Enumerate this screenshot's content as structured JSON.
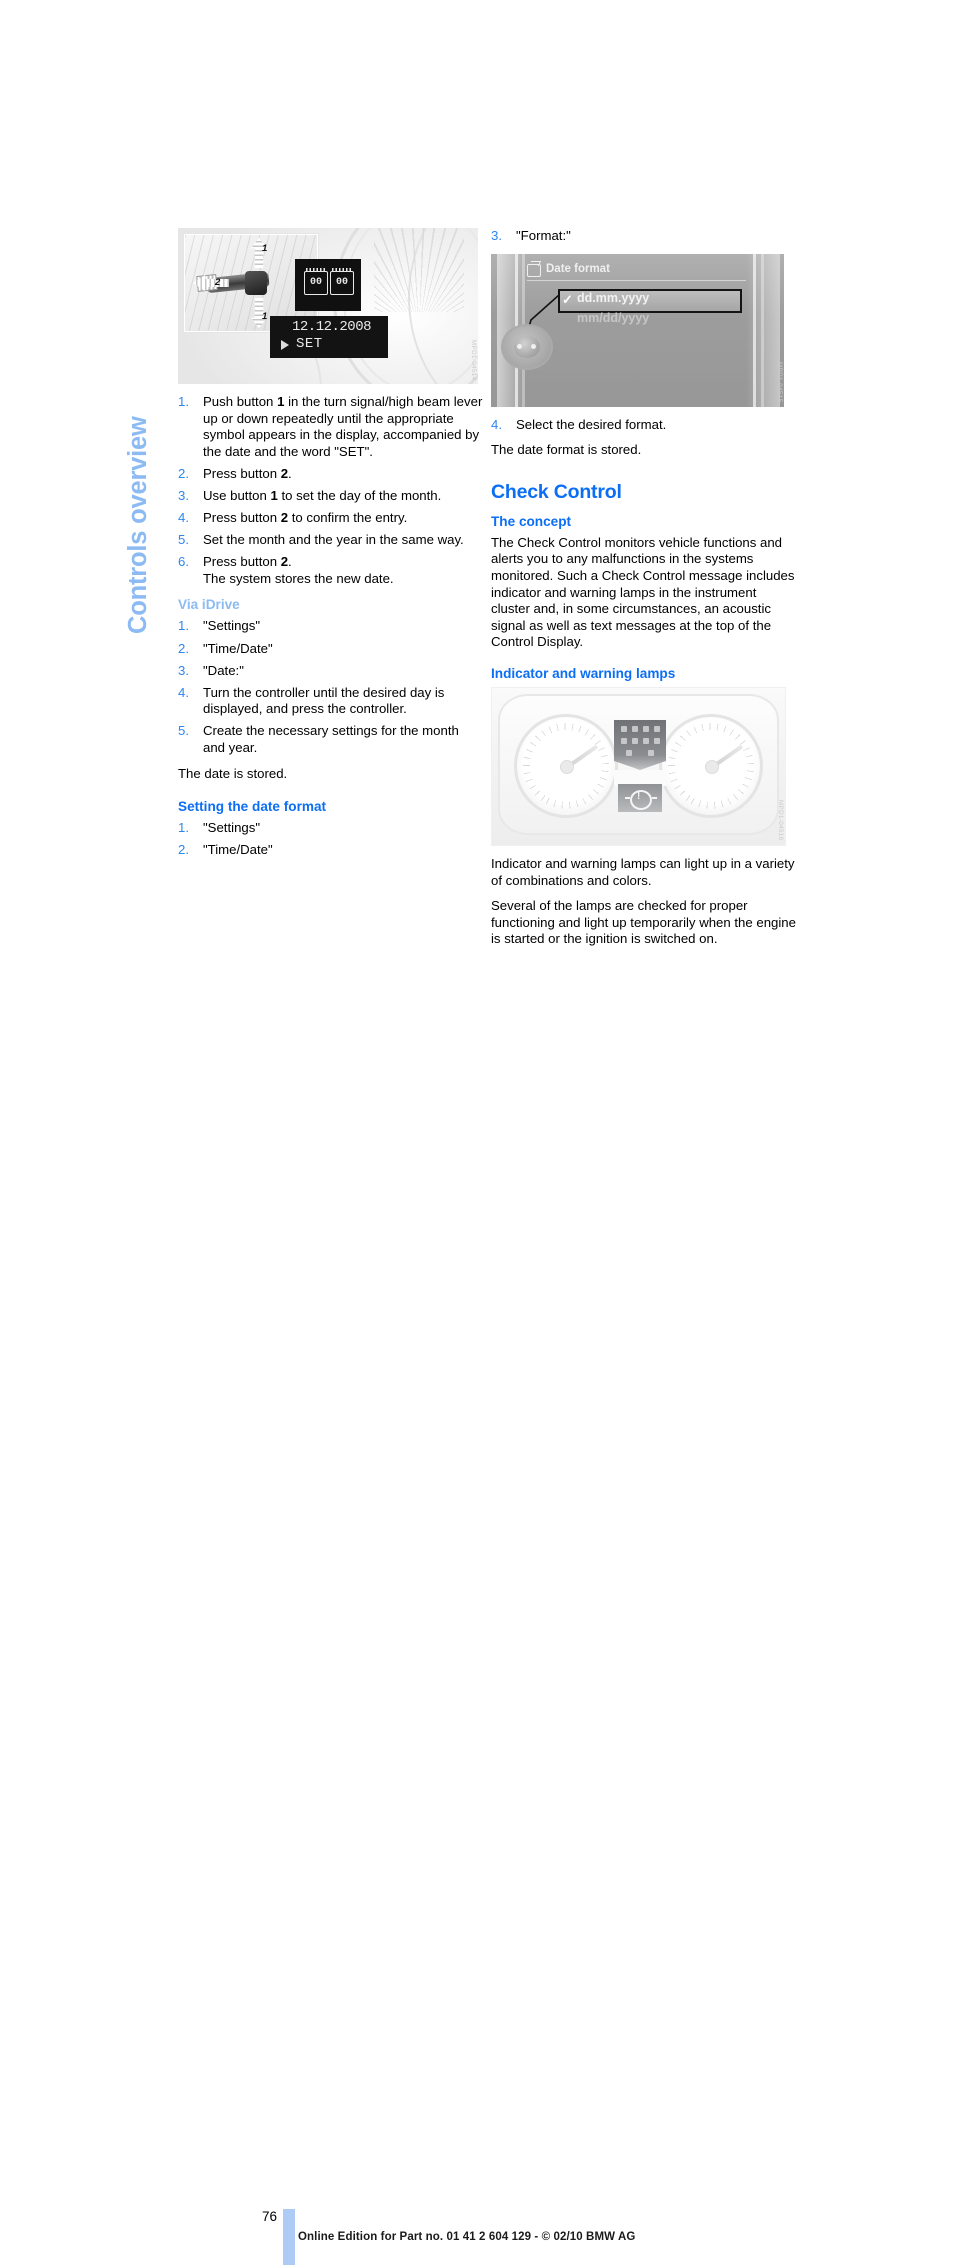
{
  "chapter": {
    "tab_label": "Controls overview"
  },
  "colors": {
    "heading_blue": "#0B6EF4",
    "list_number_blue": "#2E86F0",
    "soft_blue": "#8CBAF2",
    "page_bar_blue": "#AECBF5"
  },
  "left_column": {
    "figure_lever": {
      "caption_code": "MPD1-04514",
      "inset_label_up": "1",
      "inset_label_down": "1",
      "inset_label_left": "2",
      "display_symbol_left": "00",
      "display_symbol_right": "00",
      "display_date": "12.12.2008",
      "display_set": "SET"
    },
    "steps_manual": [
      {
        "num": "1.",
        "html": "Push button <b>1</b> in the turn signal/high beam lever up or down repeatedly until the appropriate symbol appears in the display, accompanied by the date and the word \"SET\"."
      },
      {
        "num": "2.",
        "html": "Press button <b>2</b>."
      },
      {
        "num": "3.",
        "html": "Use button <b>1</b> to set the day of the month."
      },
      {
        "num": "4.",
        "html": "Press button <b>2</b> to confirm the entry."
      },
      {
        "num": "5.",
        "html": "Set the month and the year in the same way."
      },
      {
        "num": "6.",
        "html": "Press button <b>2</b>.<br>The system stores the new date."
      }
    ],
    "via_idrive_heading": "Via iDrive",
    "steps_idrive": [
      {
        "num": "1.",
        "html": "\"Settings\""
      },
      {
        "num": "2.",
        "html": "\"Time/Date\""
      },
      {
        "num": "3.",
        "html": "\"Date:\""
      },
      {
        "num": "4.",
        "html": "Turn the controller until the desired day is displayed, and press the controller."
      },
      {
        "num": "5.",
        "html": "Create the necessary settings for the month and year."
      }
    ],
    "date_stored_note": "The date is stored.",
    "date_format_heading": "Setting the date format",
    "steps_date_format": [
      {
        "num": "1.",
        "html": "\"Settings\""
      },
      {
        "num": "2.",
        "html": "\"Time/Date\""
      }
    ]
  },
  "right_column": {
    "step_format": {
      "num": "3.",
      "html": "\"Format:\""
    },
    "figure_dateformat": {
      "title": "Date format",
      "option_selected": "dd.mm.yyyy",
      "option_other": "mm/dd/yyyy",
      "check_glyph": "✓",
      "caption_code": "MPD1-04515"
    },
    "step_select": {
      "num": "4.",
      "html": "Select the desired format."
    },
    "format_stored_note": "The date format is stored.",
    "check_control_heading": "Check Control",
    "concept_heading": "The concept",
    "concept_paragraph": "The Check Control monitors vehicle functions and alerts you to any malfunctions in the systems monitored. Such a Check Control message includes indicator and warning lamps in the instrument cluster and, in some circumstances, an acoustic signal as well as text messages at the top of the Control Display.",
    "lamps_heading": "Indicator and warning lamps",
    "figure_cluster": {
      "caption_code": "MPD1-04516"
    },
    "lamps_paragraph_1": "Indicator and warning lamps can light up in a variety of combinations and colors.",
    "lamps_paragraph_2": "Several of the lamps are checked for proper functioning and light up temporarily when the engine is started or the ignition is switched on."
  },
  "footer": {
    "page_number": "76",
    "note": "Online Edition for Part no. 01 41 2 604 129 - © 02/10 BMW AG"
  }
}
